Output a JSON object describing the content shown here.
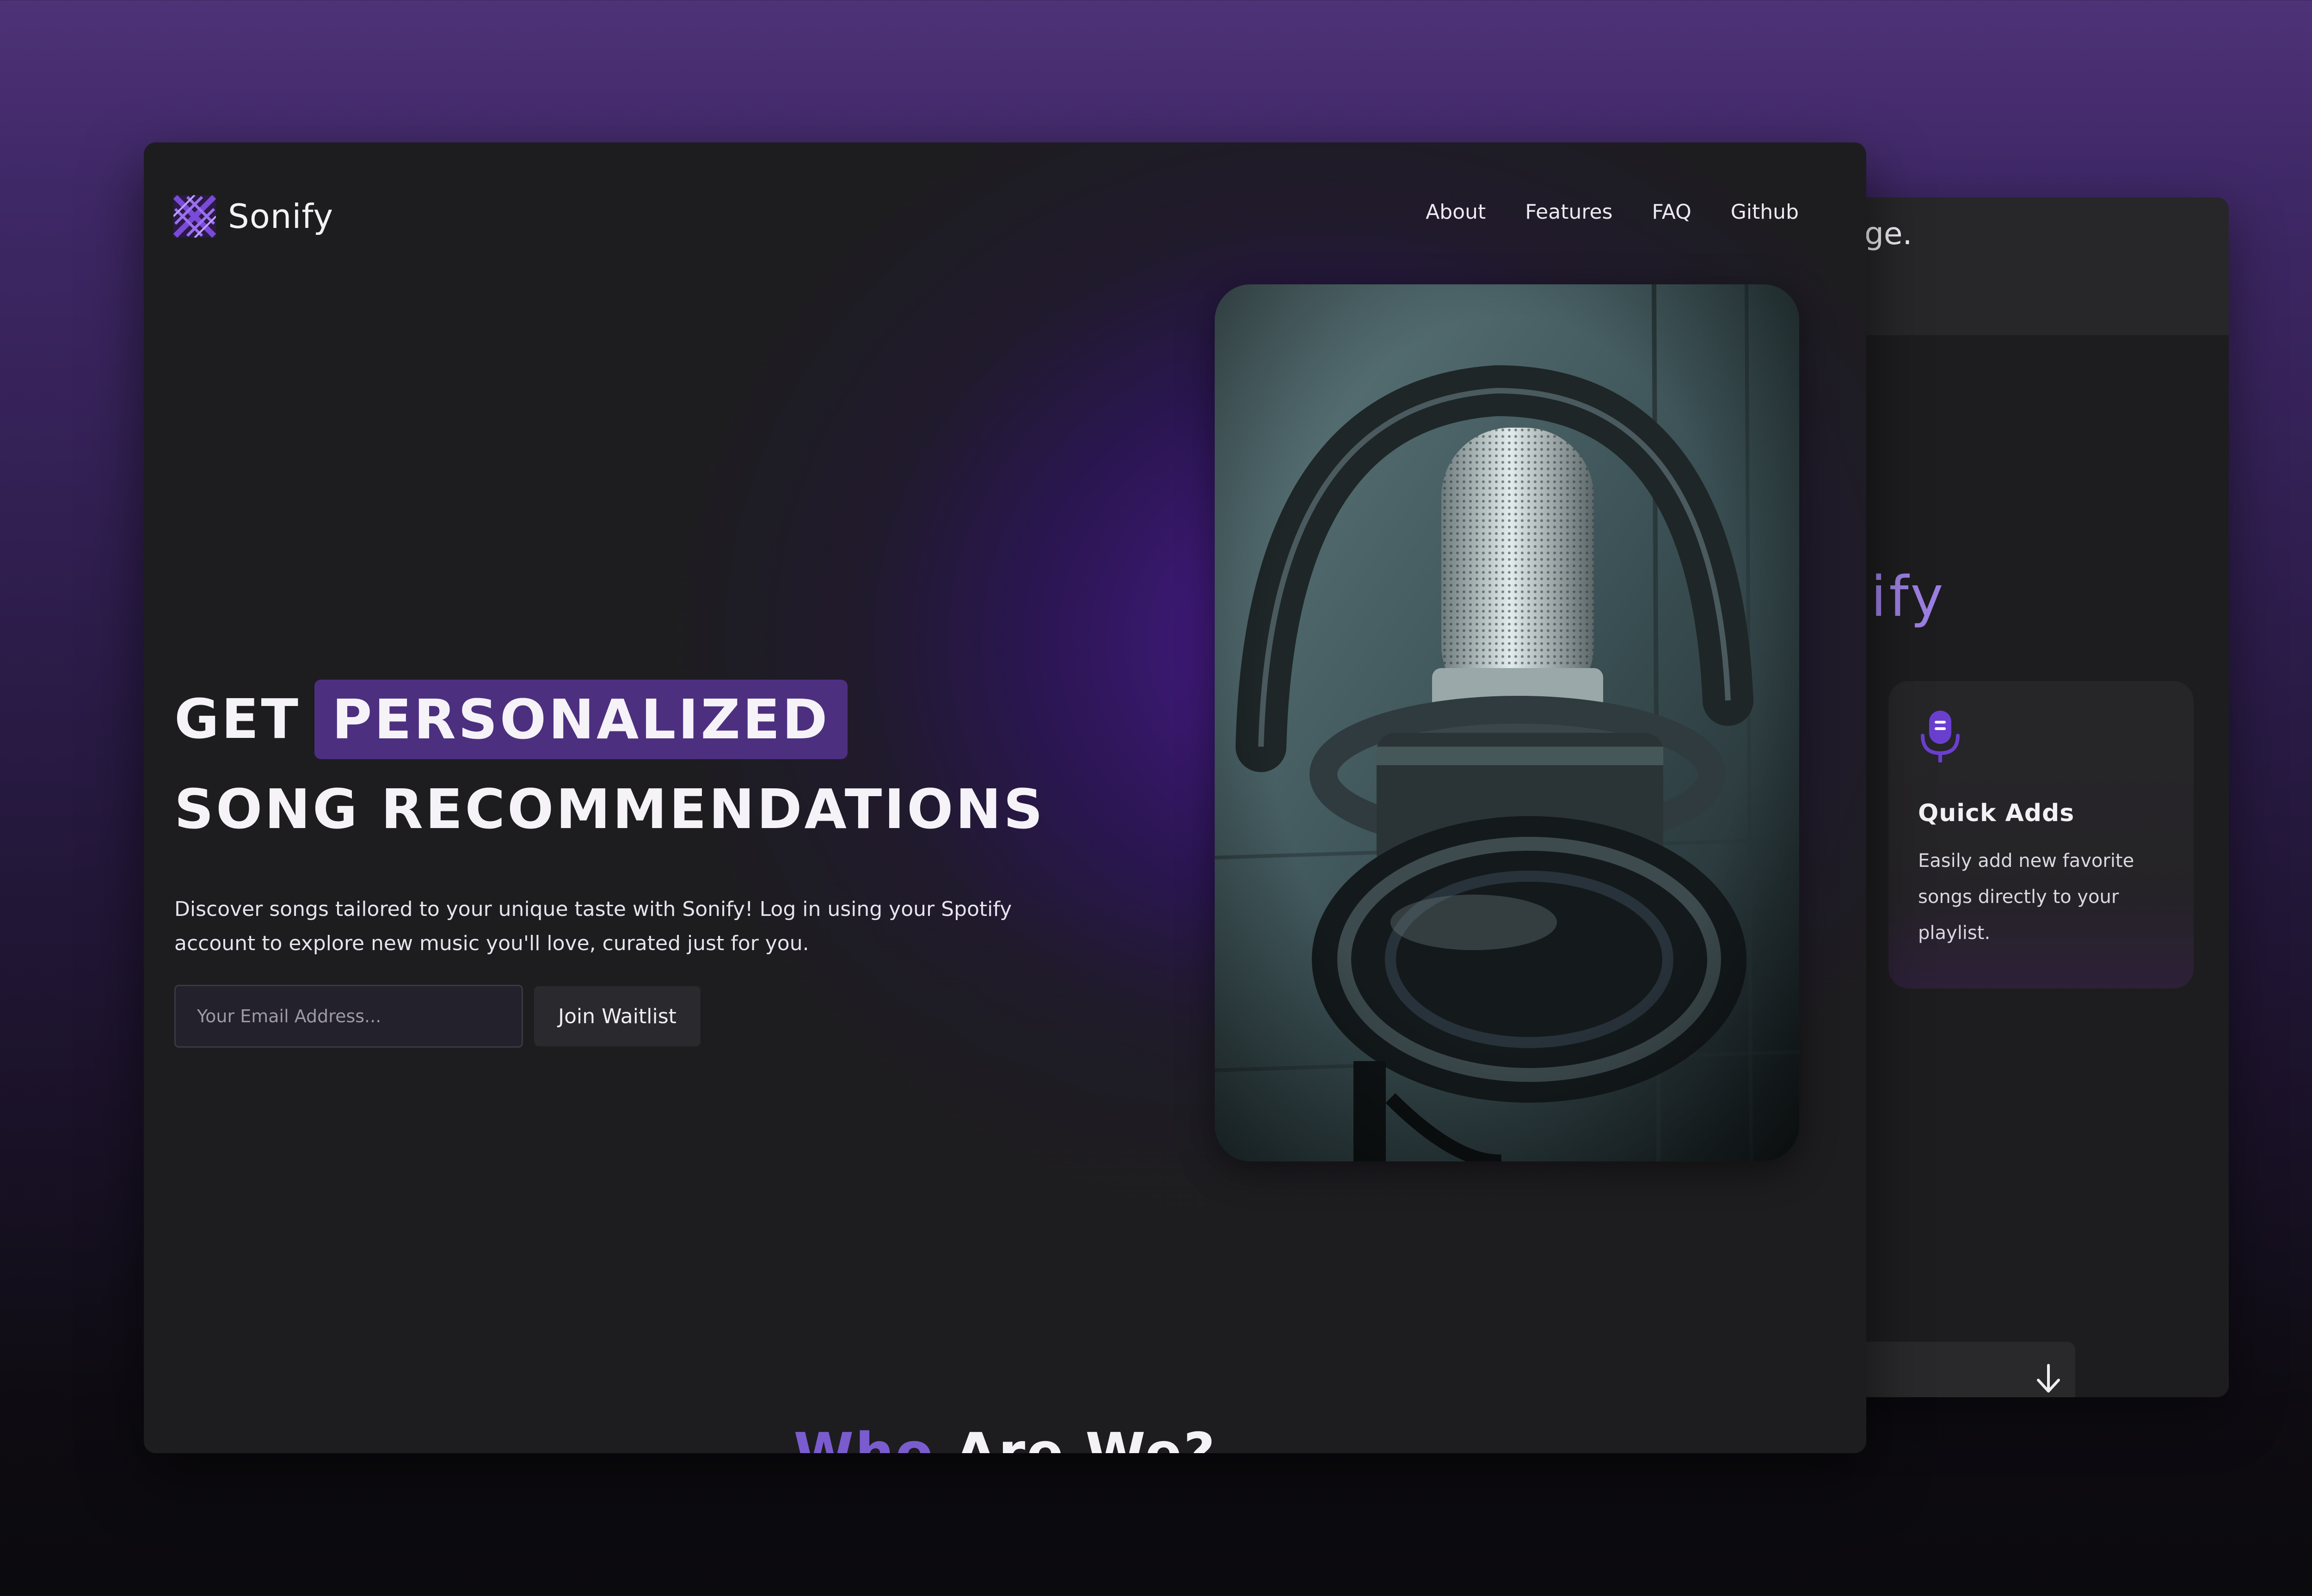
{
  "app": {
    "name": "Sonify"
  },
  "nav": [
    {
      "label": "About"
    },
    {
      "label": "Features"
    },
    {
      "label": "FAQ"
    },
    {
      "label": "Github"
    }
  ],
  "hero": {
    "title_prefix": "GET",
    "title_highlight": "PERSONALIZED",
    "title_line2": "SONG RECOMMENDATIONS",
    "description": "Discover songs tailored to your unique taste with Sonify! Log in using your Spotify account to explore new music you'll love, curated just for you.",
    "email_placeholder": "Your Email Address...",
    "join_label": "Join Waitlist"
  },
  "sections": {
    "who_accent": "Who",
    "who_rest": "Are We?"
  },
  "back_window": {
    "fragment_top": "ge.",
    "fragment_mid": "ify",
    "feature": {
      "icon": "microphone-icon",
      "title": "Quick Adds",
      "description": "Easily add new favorite songs directly to your playlist."
    },
    "arrow_icon": "arrow-down-icon"
  },
  "colors": {
    "accent": "#4d2f80",
    "accent_text": "#7a5ccf",
    "window_bg": "#1d1d1f"
  }
}
